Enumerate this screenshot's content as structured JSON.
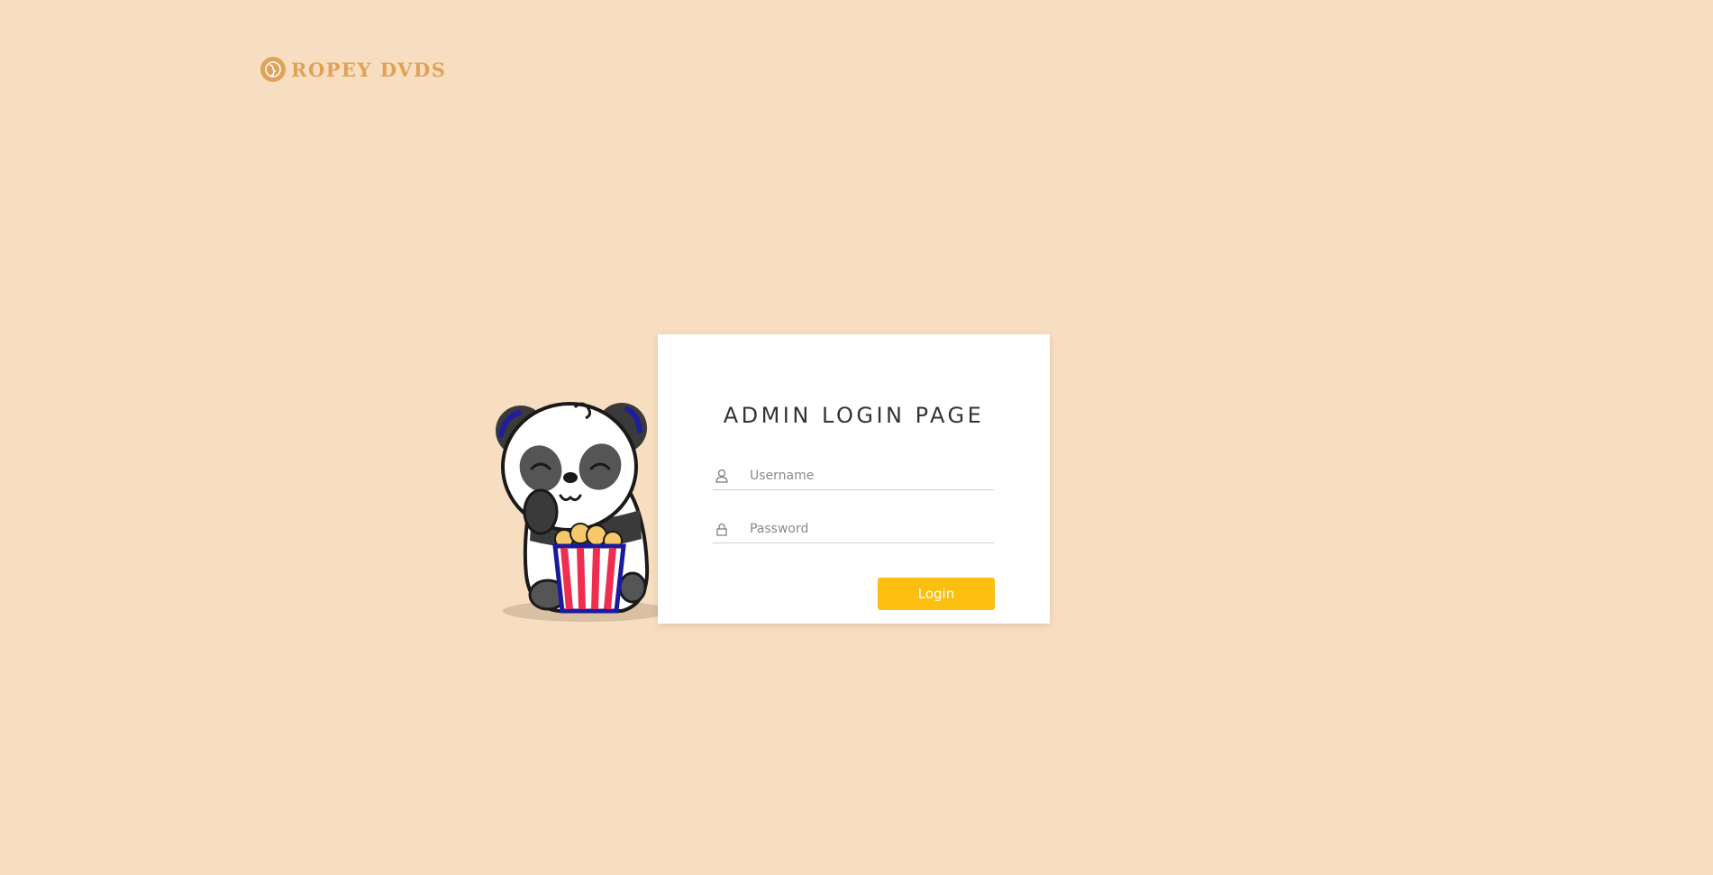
{
  "logo": {
    "text": "ROPEY DVDS",
    "icon": "film-reel-icon",
    "color": "#e0a257"
  },
  "illustration": {
    "name": "panda-eating-popcorn"
  },
  "login": {
    "title": "ADMIN LOGIN PAGE",
    "username": {
      "placeholder": "Username",
      "icon": "user-icon"
    },
    "password": {
      "placeholder": "Password",
      "icon": "lock-icon"
    },
    "button_label": "Login",
    "button_color": "#fcbf0f"
  },
  "colors": {
    "background": "#f8dec0",
    "card": "#ffffff"
  }
}
